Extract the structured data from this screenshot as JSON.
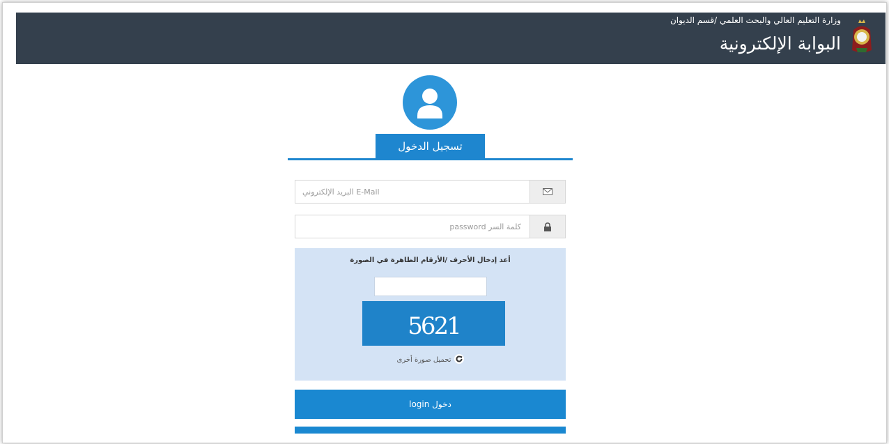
{
  "header": {
    "ministry": "وزارة التعليم العالي والبحث العلمي /قسم الديوان",
    "portal_title": "البوابة الإلكترونية",
    "bar_color": "#34404d"
  },
  "login": {
    "tab_label": "تسجيل الدخول",
    "email_placeholder": "E-Mail البريد الإلكتروني",
    "password_placeholder": "كلمة السر password",
    "accent_color": "#1e86cf"
  },
  "captcha": {
    "instruction": "أعد إدخال الأحرف /الأرقام الظاهرة في الصورة",
    "code": "5621",
    "reload_label": "تحميل صورة أخرى",
    "panel_color": "#d4e3f5"
  },
  "actions": {
    "login_label": "login دخول"
  },
  "icons": {
    "crest": "coat-of-arms-icon",
    "avatar": "user-avatar-icon",
    "email": "envelope-icon",
    "password": "lock-icon",
    "reload": "refresh-icon"
  }
}
